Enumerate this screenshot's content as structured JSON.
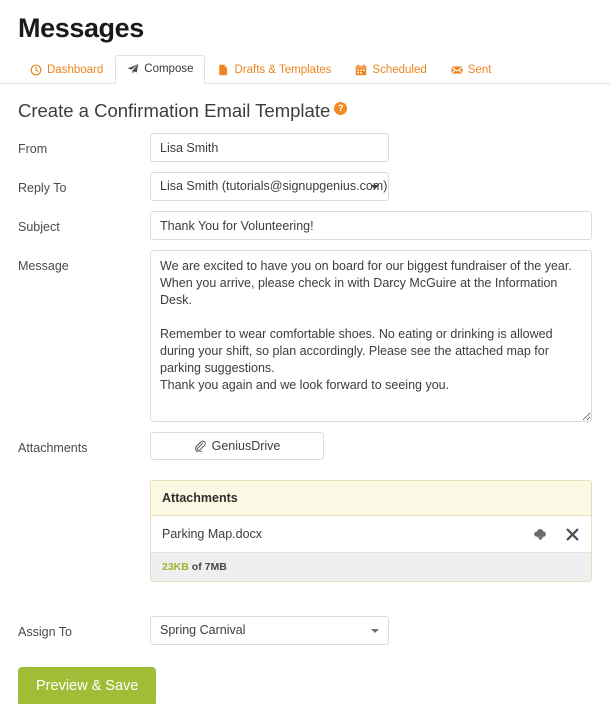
{
  "header": {
    "title": "Messages"
  },
  "tabs": [
    {
      "label": "Dashboard",
      "icon": "clock-icon",
      "active": false
    },
    {
      "label": "Compose",
      "icon": "paper-plane-icon",
      "active": true
    },
    {
      "label": "Drafts & Templates",
      "icon": "document-icon",
      "active": false
    },
    {
      "label": "Scheduled",
      "icon": "calendar-icon",
      "active": false
    },
    {
      "label": "Sent",
      "icon": "envelope-icon",
      "active": false
    }
  ],
  "section": {
    "title": "Create a Confirmation Email Template",
    "help_icon": "question-mark-icon",
    "help_label": "?"
  },
  "form": {
    "from": {
      "label": "From",
      "value": "Lisa Smith",
      "placeholder": ""
    },
    "reply_to": {
      "label": "Reply To",
      "value": "Lisa Smith (tutorials@signupgenius.com)",
      "caret_icon": "chevron-down-icon"
    },
    "subject": {
      "label": "Subject",
      "value": "Thank You for Volunteering!",
      "placeholder": ""
    },
    "message": {
      "label": "Message",
      "value": "We are excited to have you on board for our biggest fundraiser of the year. When you arrive, please check in with Darcy McGuire at the Information Desk.\n\nRemember to wear comfortable shoes. No eating or drinking is allowed during your shift, so plan accordingly. Please see the attached map for parking suggestions.\nThank you again and we look forward to seeing you.",
      "placeholder": ""
    },
    "attachments": {
      "label": "Attachments",
      "upload_button": {
        "label": "GeniusDrive",
        "icon": "paperclip-icon"
      },
      "panel": {
        "header": "Attachments",
        "files": [
          {
            "name": "Parking Map.docx",
            "download_icon": "cloud-download-icon",
            "remove_icon": "close-icon"
          }
        ],
        "usage_used": "23KB",
        "usage_rest": "of 7MB"
      }
    },
    "assign_to": {
      "label": "Assign To",
      "value": "Spring Carnival",
      "caret_icon": "chevron-down-icon"
    }
  },
  "actions": {
    "submit_label": "Preview & Save"
  },
  "colors": {
    "accent_orange": "#ee8421",
    "primary_green": "#a1bd37",
    "usage_green": "#9bb52c",
    "panel_cream": "#fbf8e4",
    "border_gray": "#dcdcdc"
  }
}
